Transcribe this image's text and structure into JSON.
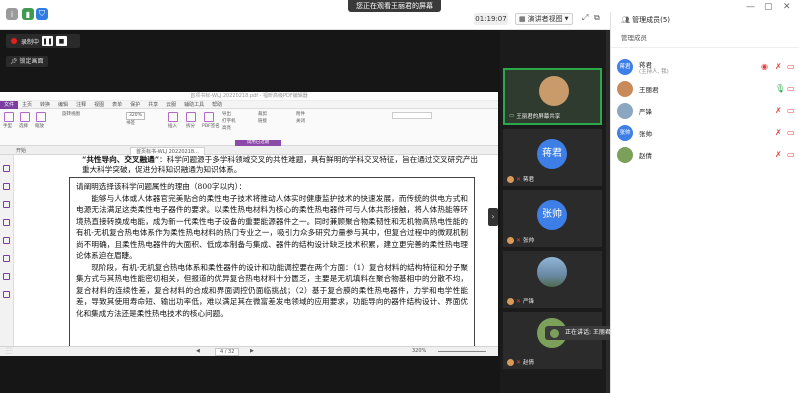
{
  "top_bar": {
    "banner": "您正在观看王丽君的屏幕",
    "timer": "01:19:07",
    "view_button": "演讲者视图",
    "panel_title": "管理成员(5)"
  },
  "recording": {
    "label": "录制中",
    "lock_label": "锁定画面"
  },
  "pdf": {
    "window_title": "首项书标-WLJ 20220218.pdf - 福昕高级PDF编辑器",
    "menu": [
      "文件",
      "主页",
      "转换",
      "编辑",
      "注释",
      "视图",
      "表单",
      "保护",
      "共享",
      "云服",
      "辅助工具",
      "帮助"
    ],
    "ribbon_labels": [
      "手型",
      "选择",
      "缩放",
      "旋转视图",
      "320%",
      "书签",
      "插入",
      "拆分",
      "PDF签名",
      "导出",
      "打字机",
      "高亮",
      "裁剪",
      "链接",
      "试用已过期",
      "附件",
      "关闭"
    ],
    "tab_label": "首页标书-WLJ 20220218...",
    "side_tab": "开始",
    "heading_bold": "“共性导向、交叉融通”",
    "heading_rest": "：科学问题源于多学科领域交叉的共性难题，具有鲜明的学科交叉特征，旨在通过交叉研究产出重大科学突破，促进分科知识融通为知识体系。",
    "box_title": "请阐明选择该科学问题属性的理由（800字以内）：",
    "para1": "能够与人体或人体器官完美贴合的柔性电子技术将推动人体实时健康监护技术的快速发展，而传统的供电方式和电源无法满足这类柔性电子器件的要求。以柔性热电材料为核心的柔性热电器件可与人体共形接触，将人体热能等环境热直接转换成电能，成为新一代柔性电子设备的重要能源器件之一。同时兼顾聚合物柔韧性和无机物高热电性能的有机-无机复合热电体系作为柔性热电材料的热门专业之一，吸引力众多研究力量参与其中，但复合过程中的微观机制尚不明确，且柔性热电器件的大面积、低成本制备与集成、器件的结构设计缺乏技术积累，建立更完善的柔性热电理论体系迫在眉睫。",
    "para2": "现阶段，有机-无机复合热电体系和柔性器件的设计和功能调控要在两个方面：（1）复合材料的结构特征和分子聚集方式与其热电性能密切相关，但报道的优异复合热电材料十分匮乏，主要是无机填料在聚合物基相中的分散不均，复合材料的连续性差，复合材料的合成和界面调控仍面临挑战；（2）基于复合膜的柔性热电器件，力学和电学性能差，导致其使用寿命短、输出功率低，难以满足其在微富差发电领域的应用要求，功能导向的器件结构设计、界面优化和集成方法还是柔性热电技术的核心问题。",
    "page_indicator": "4 / 32",
    "zoom": "320%"
  },
  "tiles": [
    {
      "name": "王丽君的屏幕共享",
      "initial": ""
    },
    {
      "name": "蒋君",
      "initial": "蒋君"
    },
    {
      "name": "张帅",
      "initial": "张帅"
    },
    {
      "name": "严锋",
      "initial": ""
    },
    {
      "name": "赵倩",
      "initial": ""
    }
  ],
  "toast": "正在讲话: 王丽君;",
  "panel": {
    "tab": "管理成员",
    "members": [
      {
        "name": "蒋君",
        "sub": "(主持人, 我)",
        "initial": "蒋君",
        "color": "#3d7fe6"
      },
      {
        "name": "王丽君",
        "sub": "",
        "initial": "",
        "color": "#c98a5a"
      },
      {
        "name": "严锋",
        "sub": "",
        "initial": "",
        "color": "#8aa6c0"
      },
      {
        "name": "张帅",
        "sub": "",
        "initial": "张帅",
        "color": "#3d7fe6"
      },
      {
        "name": "赵倩",
        "sub": "",
        "initial": "",
        "color": "#7aa05a"
      }
    ]
  },
  "colors": {
    "accent_purple": "#7a3fa1",
    "active_green": "#2ba84a",
    "mute_red": "#e24141",
    "avatar_blue": "#3d7fe6"
  }
}
